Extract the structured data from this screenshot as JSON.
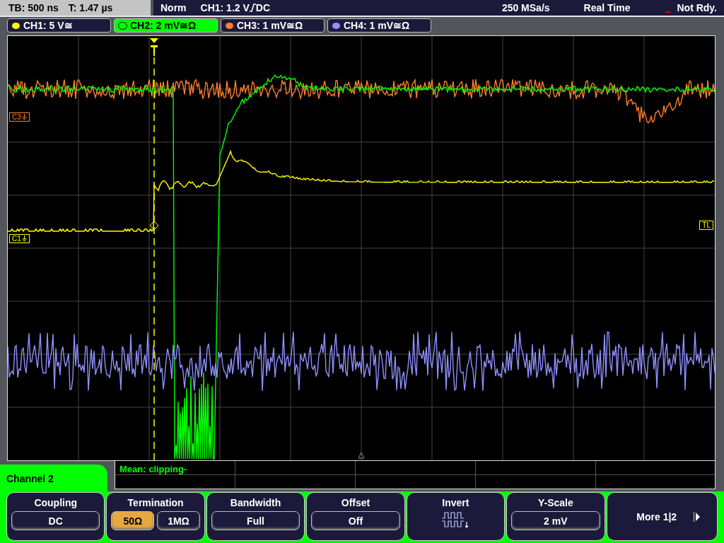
{
  "status_bar": {
    "timebase": "TB: 500 ns",
    "trigger_time": "T: 1.47 µs",
    "trigger_mode": "Norm",
    "trigger_source": "CH1: 1.2 V",
    "trigger_coupling": "DC",
    "sample_rate": "250 MSa/s",
    "acquisition": "Real Time",
    "state": "Not Rdy."
  },
  "channels": [
    {
      "label": "CH1: 5 V≅",
      "color": "#ffff00",
      "selected": false
    },
    {
      "label": "CH2: 2 mV≅Ω",
      "color": "#00ff00",
      "selected": true
    },
    {
      "label": "CH3: 1 mV≅Ω",
      "color": "#ff7f27",
      "selected": false
    },
    {
      "label": "CH4: 1 mV≅Ω",
      "color": "#9090ff",
      "selected": false
    }
  ],
  "markers": [
    {
      "kind": "channel",
      "label": "C3",
      "color": "#ff7f27"
    },
    {
      "kind": "channel",
      "label": "C1",
      "color": "#ffff00"
    },
    {
      "kind": "trigger_level",
      "label": "TL",
      "color": "#ffff00"
    }
  ],
  "measurement": "Mean: clipping-",
  "menu": {
    "title": "Channel 2",
    "buttons": [
      {
        "kind": "value",
        "label": "Coupling",
        "value": "DC"
      },
      {
        "kind": "options",
        "label": "Termination",
        "options": [
          {
            "label": "50Ω",
            "selected": true
          },
          {
            "label": "1MΩ",
            "selected": false
          }
        ]
      },
      {
        "kind": "value",
        "label": "Bandwidth",
        "value": "Full"
      },
      {
        "kind": "value",
        "label": "Offset",
        "value": "Off"
      },
      {
        "kind": "icon",
        "label": "Invert"
      },
      {
        "kind": "value",
        "label": "Y-Scale",
        "value": "2 mV"
      },
      {
        "kind": "next",
        "label": "More 1|2"
      }
    ]
  }
}
